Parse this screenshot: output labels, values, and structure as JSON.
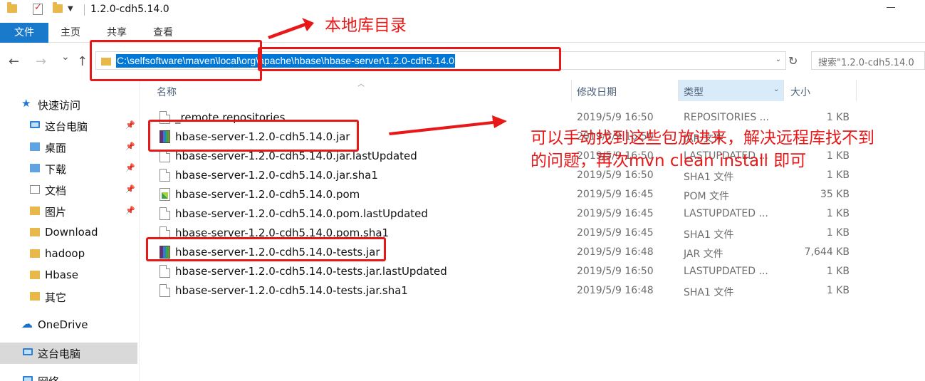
{
  "window": {
    "title": "1.2.0-cdh5.14.0"
  },
  "ribbon": {
    "file": "文件",
    "tabs": [
      "主页",
      "共享",
      "查看"
    ]
  },
  "nav": {
    "back": "←",
    "forward": "→",
    "recent": "⌄",
    "up": "↑",
    "address": "C:\\selfsoftware\\maven\\local\\org\\apache\\hbase\\hbase-server\\1.2.0-cdh5.14.0",
    "refresh": "↻",
    "search_placeholder": "搜索\"1.2.0-cdh5.14.0"
  },
  "sidebar": {
    "quick_access": "快速访问",
    "items": [
      {
        "label": "这台电脑",
        "icon": "pc-icon",
        "pinned": true
      },
      {
        "label": "桌面",
        "icon": "folder-icon",
        "pinned": true
      },
      {
        "label": "下载",
        "icon": "download-folder-icon",
        "pinned": true
      },
      {
        "label": "文档",
        "icon": "documents-folder-icon",
        "pinned": true
      },
      {
        "label": "图片",
        "icon": "pictures-folder-icon",
        "pinned": true
      },
      {
        "label": "Download",
        "icon": "folder-icon",
        "pinned": false
      },
      {
        "label": "hadoop",
        "icon": "folder-icon",
        "pinned": false
      },
      {
        "label": "Hbase",
        "icon": "folder-icon",
        "pinned": false
      },
      {
        "label": "其它",
        "icon": "folder-icon",
        "pinned": false
      }
    ],
    "onedrive": "OneDrive",
    "this_pc": "这台电脑",
    "network": "网络"
  },
  "columns": {
    "name": "名称",
    "date": "修改日期",
    "type": "类型",
    "size": "大小"
  },
  "files": [
    {
      "name": "_remote.repositories",
      "date": "2019/5/9 16:50",
      "type": "REPOSITORIES ...",
      "size": "1 KB",
      "icon": "file-icon"
    },
    {
      "name": "hbase-server-1.2.0-cdh5.14.0.jar",
      "date": "2019/5/9 16:50",
      "type": "JAR 文件",
      "size": "",
      "icon": "jar-icon"
    },
    {
      "name": "hbase-server-1.2.0-cdh5.14.0.jar.lastUpdated",
      "date": "2019/5/9 16:50",
      "type": "LASTUPDATED ...",
      "size": "1 KB",
      "icon": "file-icon"
    },
    {
      "name": "hbase-server-1.2.0-cdh5.14.0.jar.sha1",
      "date": "2019/5/9 16:50",
      "type": "SHA1 文件",
      "size": "1 KB",
      "icon": "file-icon"
    },
    {
      "name": "hbase-server-1.2.0-cdh5.14.0.pom",
      "date": "2019/5/9 16:45",
      "type": "POM 文件",
      "size": "35 KB",
      "icon": "pom-icon"
    },
    {
      "name": "hbase-server-1.2.0-cdh5.14.0.pom.lastUpdated",
      "date": "2019/5/9 16:45",
      "type": "LASTUPDATED ...",
      "size": "1 KB",
      "icon": "file-icon"
    },
    {
      "name": "hbase-server-1.2.0-cdh5.14.0.pom.sha1",
      "date": "2019/5/9 16:45",
      "type": "SHA1 文件",
      "size": "1 KB",
      "icon": "file-icon"
    },
    {
      "name": "hbase-server-1.2.0-cdh5.14.0-tests.jar",
      "date": "2019/5/9 16:48",
      "type": "JAR 文件",
      "size": "7,644 KB",
      "icon": "jar-icon"
    },
    {
      "name": "hbase-server-1.2.0-cdh5.14.0-tests.jar.lastUpdated",
      "date": "2019/5/9 16:50",
      "type": "LASTUPDATED ...",
      "size": "1 KB",
      "icon": "file-icon"
    },
    {
      "name": "hbase-server-1.2.0-cdh5.14.0-tests.jar.sha1",
      "date": "2019/5/9 16:48",
      "type": "SHA1 文件",
      "size": "1 KB",
      "icon": "file-icon"
    }
  ],
  "annotations": {
    "local_repo": "本地库目录",
    "note_line1": "可以手动找到这些包放进来，解决远程库找不到",
    "note_line2": "的问题，再次mvn clean install 即可",
    "color": "#e81818"
  }
}
